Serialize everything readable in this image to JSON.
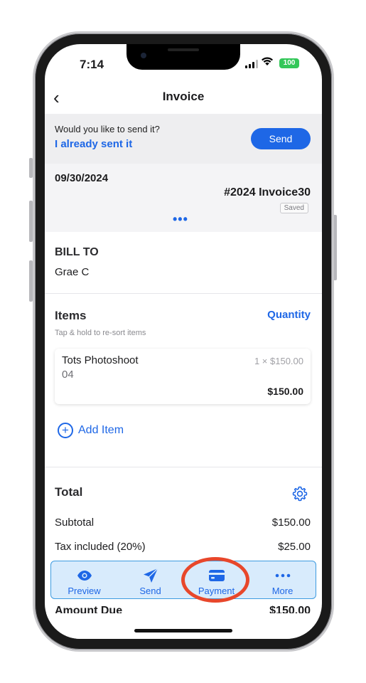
{
  "status_bar": {
    "time": "7:14",
    "battery": "100"
  },
  "nav": {
    "title": "Invoice",
    "back_glyph": "‹"
  },
  "banner": {
    "question": "Would you like to send it?",
    "link": "I already sent it",
    "send_label": "Send"
  },
  "invoice_header": {
    "date": "09/30/2024",
    "number": "#2024 Invoice30",
    "badge": "Saved",
    "more_dots": "•••"
  },
  "bill_to": {
    "label": "BILL TO",
    "name": "Grae C"
  },
  "items": {
    "title": "Items",
    "quantity_link": "Quantity",
    "hint": "Tap & hold to re-sort items",
    "list": [
      {
        "name": "Tots Photoshoot",
        "sub": "04",
        "calc": "1 × $150.00",
        "amount": "$150.00"
      }
    ],
    "add_label": "Add Item"
  },
  "totals": {
    "title": "Total",
    "subtotal_label": "Subtotal",
    "subtotal_value": "$150.00",
    "tax_label": "Tax included (20%)",
    "tax_value": "$25.00",
    "amount_due_label": "Amount Due",
    "amount_due_value": "$150.00"
  },
  "tabbar": {
    "tabs": [
      {
        "label": "Preview",
        "icon": "eye-icon"
      },
      {
        "label": "Send",
        "icon": "paper-plane-icon"
      },
      {
        "label": "Payment",
        "icon": "credit-card-icon"
      },
      {
        "label": "More",
        "icon": "more-dots-icon"
      }
    ]
  },
  "colors": {
    "accent": "#1e67e6",
    "tabbar_bg": "#d8ebfc",
    "highlight": "#e8472b",
    "battery": "#34c759"
  }
}
